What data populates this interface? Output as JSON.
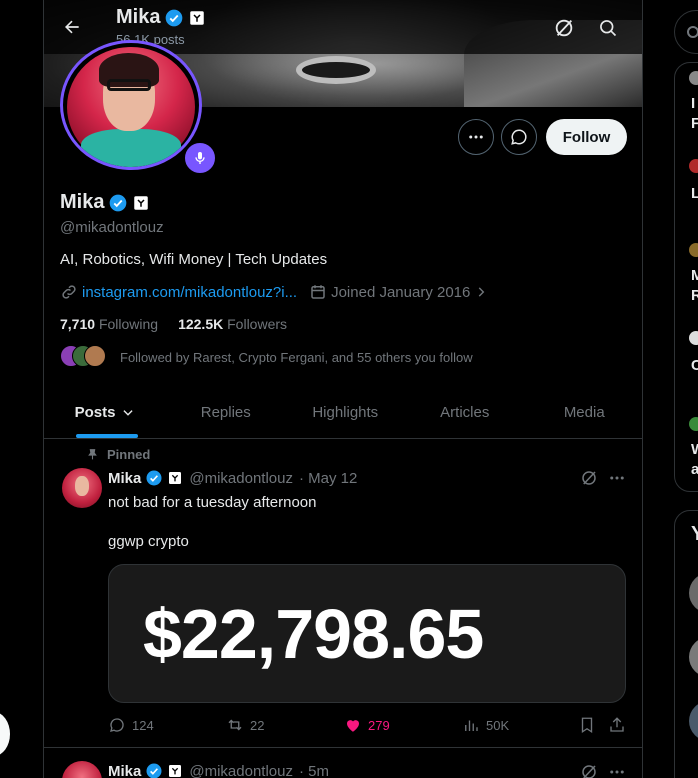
{
  "header": {
    "name": "Mika",
    "posts_count": "56.1K posts"
  },
  "profile": {
    "name": "Mika",
    "handle": "@mikadontlouz",
    "bio": "AI, Robotics, Wifi Money | Tech Updates",
    "link": "instagram.com/mikadontlouz?i...",
    "joined": "Joined January 2016",
    "following_count": "7,710",
    "following_label": "Following",
    "followers_count": "122.5K",
    "followers_label": "Followers",
    "followed_by": "Followed by Rarest, Crypto Fergani, and 55 others you follow",
    "follow_button": "Follow",
    "avatar_ring_color": "#7856ff",
    "verified_color": "#1d9bf0"
  },
  "tabs": [
    {
      "label": "Posts",
      "active": true
    },
    {
      "label": "Replies"
    },
    {
      "label": "Highlights"
    },
    {
      "label": "Articles"
    },
    {
      "label": "Media"
    }
  ],
  "post": {
    "pinned_label": "Pinned",
    "name": "Mika",
    "handle": "@mikadontlouz",
    "time": "· May 12",
    "text_line1": "not bad for a tuesday afternoon",
    "text_line2": "ggwp crypto",
    "media_amount": "$22,798.65",
    "replies": "124",
    "reposts": "22",
    "likes": "279",
    "views": "50K",
    "like_color": "#f91880"
  },
  "post2": {
    "name": "Mika",
    "handle": "@mikadontlouz",
    "time": "· 5m"
  },
  "right_sidebar": {
    "letters": [
      "I",
      "F",
      "L",
      "M",
      "R",
      "C",
      "W",
      "a"
    ],
    "section_initial": "Y"
  }
}
